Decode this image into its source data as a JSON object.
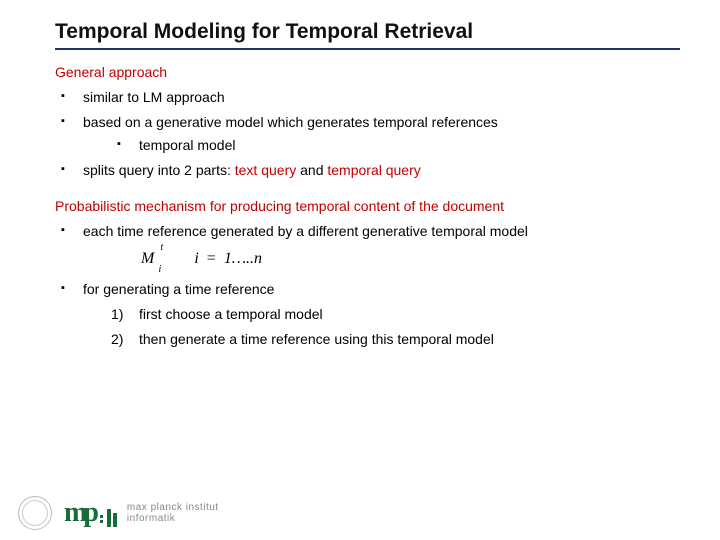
{
  "title": "Temporal Modeling for Temporal Retrieval",
  "section1": "General approach",
  "bullets1": [
    "similar to LM approach",
    "based on a generative model which generates temporal references"
  ],
  "sub1": "temporal model",
  "bullet1c_prefix": "splits query into 2 parts: ",
  "bullet1c_hl1": "text query",
  "bullet1c_mid": " and ",
  "bullet1c_hl2": "temporal query",
  "section2": "Probabilistic mechanism for producing temporal content of the document",
  "bullets2a": "each time reference generated by a different generative temporal model",
  "math": {
    "M": "M",
    "sup": "t",
    "sub": "i",
    "i": "i",
    "eq": "=",
    "range": "1…..n"
  },
  "bullets2b": "for generating a time reference",
  "steps": {
    "n1": "1)",
    "t1": "first choose a temporal model",
    "n2": "2)",
    "t2": "then generate a time reference using this temporal model"
  },
  "footer": {
    "mpi1": "max planck institut",
    "mpi2": "informatik"
  }
}
